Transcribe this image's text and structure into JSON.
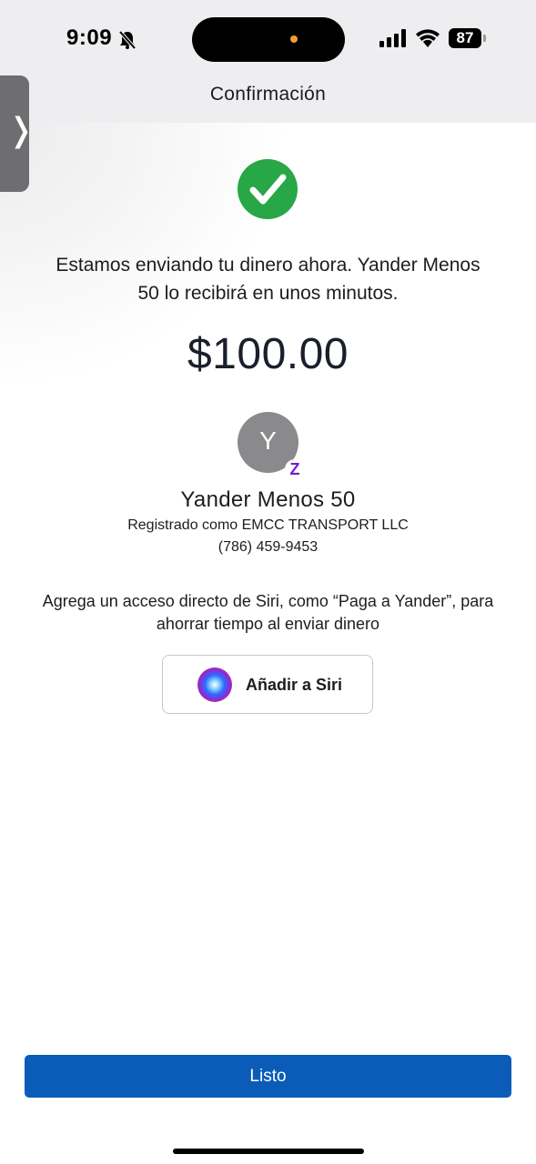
{
  "status_bar": {
    "time": "9:09",
    "battery": "87",
    "icons": [
      "bell-slash-icon",
      "signal-icon",
      "wifi-icon",
      "battery-icon"
    ]
  },
  "header": {
    "title": "Confirmación"
  },
  "confirmation": {
    "icon": "checkmark-circle-icon",
    "message": "Estamos enviando tu dinero ahora. Yander Menos 50 lo recibirá en unos minutos.",
    "amount": "$100.00"
  },
  "recipient": {
    "initial": "Y",
    "badge": "Z",
    "name": "Yander Menos 50",
    "registered": "Registrado como EMCC TRANSPORT LLC",
    "phone": "(786) 459-9453"
  },
  "siri": {
    "prompt": "Agrega un acceso directo de Siri, como “Paga a Yander”, para ahorrar tiempo al enviar dinero",
    "button_label": "Añadir a Siri"
  },
  "footer": {
    "done_label": "Listo"
  },
  "colors": {
    "primary": "#0a5cb8",
    "success": "#27a745",
    "zelle": "#6d1ed4"
  }
}
